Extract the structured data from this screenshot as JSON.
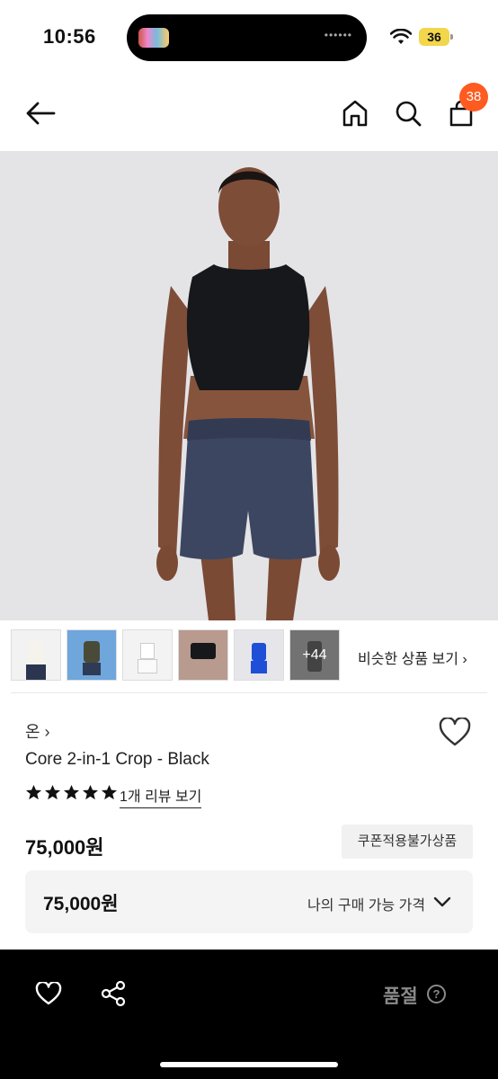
{
  "status_bar": {
    "time": "10:56",
    "battery": "36"
  },
  "header": {
    "cart_count": "38",
    "icons": [
      "back-arrow-icon",
      "home-icon",
      "search-icon",
      "shopping-bag-icon"
    ]
  },
  "thumbnails": {
    "more_label": "+44",
    "similar_label": "비슷한 상품 보기 ›"
  },
  "product": {
    "brand": "온 ›",
    "name": "Core 2-in-1 Crop - Black",
    "rating_stars": 5,
    "review_link": "1개 리뷰 보기",
    "price": "75,000원",
    "coupon_label": "쿠폰적용불가상품",
    "my_price": "75,000원",
    "my_price_label": "나의 구매 가능 가격"
  },
  "bottom_bar": {
    "status": "품절",
    "help": "?"
  },
  "colors": {
    "badge": "#ff5a1f",
    "bottom_bar": "#000000",
    "battery": "#f2d64b"
  }
}
